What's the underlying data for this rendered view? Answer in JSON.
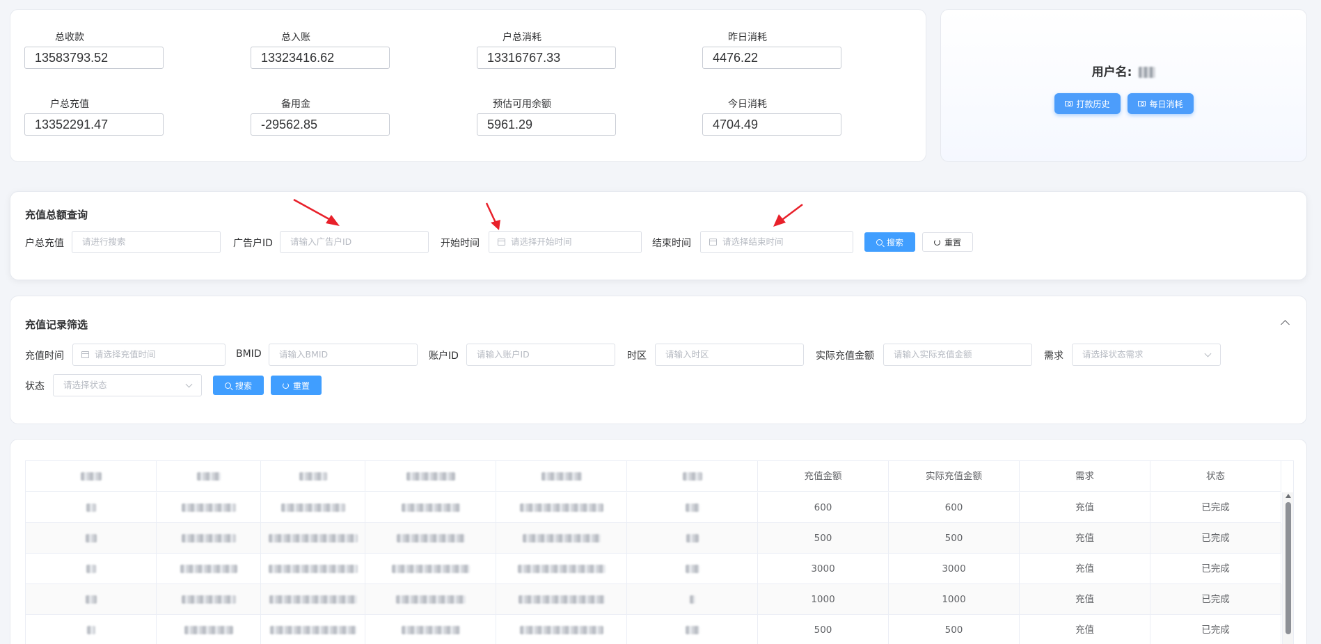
{
  "stats": [
    {
      "label": "总收款",
      "value": "13583793.52"
    },
    {
      "label": "总入账",
      "value": "13323416.62"
    },
    {
      "label": "户总消耗",
      "value": "13316767.33"
    },
    {
      "label": "昨日消耗",
      "value": "4476.22"
    },
    {
      "label": "户总充值",
      "value": "13352291.47"
    },
    {
      "label": "备用金",
      "value": "-29562.85"
    },
    {
      "label": "预估可用余额",
      "value": "5961.29"
    },
    {
      "label": "今日消耗",
      "value": "4704.49"
    }
  ],
  "user": {
    "name_label": "用户名:",
    "history_button": "打款历史",
    "daily_button": "每日消耗"
  },
  "query": {
    "title": "充值总额查询",
    "total_label": "户总充值",
    "total_placeholder": "请进行搜索",
    "ad_id_label": "广告户ID",
    "ad_id_placeholder": "请输入广告户ID",
    "start_label": "开始时间",
    "start_placeholder": "请选择开始时间",
    "end_label": "结束时间",
    "end_placeholder": "请选择结束时间",
    "search_button": "搜索",
    "reset_button": "重置",
    "arrow_color": "#e8202a"
  },
  "filter": {
    "title": "充值记录筛选",
    "time_label": "充值时间",
    "time_placeholder": "请选择充值时间",
    "bmid_label": "BMID",
    "bmid_placeholder": "请输入BMID",
    "account_label": "账户ID",
    "account_placeholder": "请输入账户ID",
    "timezone_label": "时区",
    "timezone_placeholder": "请输入时区",
    "actual_label": "实际充值金额",
    "actual_placeholder": "请输入实际充值金额",
    "demand_label": "需求",
    "demand_placeholder": "请选择状态需求",
    "status_label": "状态",
    "status_placeholder": "请选择状态",
    "search_button": "搜索",
    "reset_button": "重置"
  },
  "table": {
    "headers": [
      "充值金额",
      "实际充值金额",
      "需求",
      "状态"
    ],
    "rows": [
      {
        "amount": "600",
        "actual": "600",
        "demand": "充值",
        "status": "已完成"
      },
      {
        "amount": "500",
        "actual": "500",
        "demand": "充值",
        "status": "已完成"
      },
      {
        "amount": "3000",
        "actual": "3000",
        "demand": "充值",
        "status": "已完成"
      },
      {
        "amount": "1000",
        "actual": "1000",
        "demand": "充值",
        "status": "已完成"
      },
      {
        "amount": "500",
        "actual": "500",
        "demand": "充值",
        "status": "已完成"
      }
    ]
  },
  "icons": {
    "history": "money-icon",
    "daily": "money-icon",
    "search": "search-icon",
    "reset": "refresh-icon",
    "calendar": "calendar-icon",
    "dropdown": "chevron-down-icon",
    "collapse": "chevron-up-icon"
  },
  "colors": {
    "primary": "#409eff",
    "user_button": "#4c9dfb",
    "arrow": "#e8202a"
  }
}
